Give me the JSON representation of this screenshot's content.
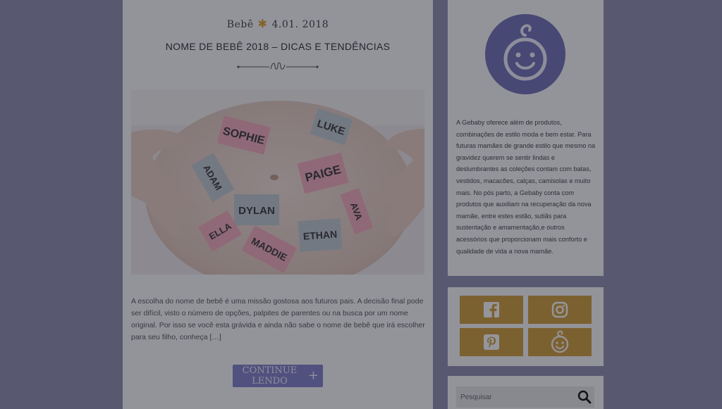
{
  "post": {
    "category": "Bebê",
    "date": "4.01. 2018",
    "title": "NOME DE BEBÊ 2018 – DICAS E TENDÊNCIAS",
    "excerpt": "A escolha do nome de bebê é uma missão gostosa aos futuros pais. A decisão final pode ser difícil, visto o número de opções, palpites de parentes ou na busca por um nome original. Por isso se você esta grávida e ainda não sabe o nome de bebê que irá escolher para seu filho, conheça […]",
    "continue_label": "CONTINUE LENDO",
    "continue_icon": "plus-icon",
    "image_labels": [
      "SOPHIE",
      "LUKE",
      "ADAM",
      "PAIGE",
      "DYLAN",
      "AVA",
      "ELLA",
      "ETHAN",
      "MADDIE"
    ]
  },
  "sidebar": {
    "about_text": "A Gebaby oferece além de produtos, combinações de estilo moda e bem estar. Para futuras mamães de grande estilo que mesmo na gravidez querem se sentir lindas e deslumbrantes as coleções contam com batas, vestidos, macacões, calças, camisolas e muito mais. No pós parto, a Gebaby conta com produtos que auxiliam na recuperação da nova mamãe, entre estes estão, sutiãs para sustentação e amamentação,e outros acessórios que proporcionam mais conforto e qualidade de vida a nova mamãe.",
    "social": [
      "facebook-icon",
      "instagram-icon",
      "pinterest-icon",
      "gebaby-icon"
    ],
    "search_placeholder": "Pesquisar"
  },
  "colors": {
    "accent_purple": "#7d7ec0",
    "accent_gold": "#c99a3a",
    "overlay": "rgba(20,20,35,0.42)"
  }
}
